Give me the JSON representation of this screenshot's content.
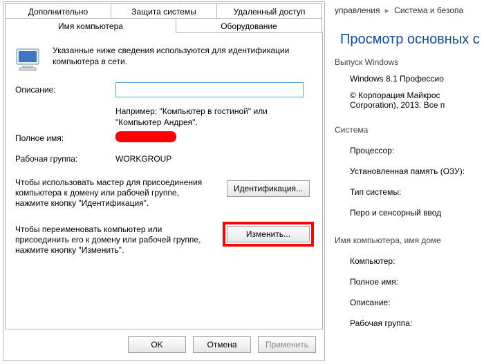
{
  "dialog": {
    "tabs": {
      "additional": "Дополнительно",
      "protection": "Защита системы",
      "remote": "Удаленный доступ",
      "computer_name": "Имя компьютера",
      "hardware": "Оборудование"
    },
    "intro": "Указанные ниже сведения используются для идентификации компьютера в сети.",
    "labels": {
      "description": "Описание:",
      "full_name": "Полное имя:",
      "workgroup": "Рабочая группа:"
    },
    "values": {
      "description": "",
      "full_name": "",
      "workgroup": "WORKGROUP"
    },
    "hint": "Например: \"Компьютер в гостиной\" или \"Компьютер Андрея\".",
    "wizard_text": "Чтобы использовать мастер для присоединения компьютера к домену или рабочей группе, нажмите кнопку \"Идентификация\".",
    "rename_text": "Чтобы переименовать компьютер или присоединить его к домену или рабочей группе, нажмите кнопку \"Изменить\".",
    "buttons": {
      "identify": "Идентификация...",
      "change": "Изменить...",
      "ok": "OK",
      "cancel": "Отмена",
      "apply": "Применить"
    }
  },
  "right": {
    "breadcrumb": {
      "part1": "управления",
      "part2": "Система и безопа"
    },
    "header": "Просмотр основных с",
    "group1_label": "Выпуск Windows",
    "edition": "Windows 8.1 Профессио",
    "copyright": "© Корпорация Майкрос Corporation), 2013. Все п",
    "group2_label": "Система",
    "proc": "Процессор:",
    "ram": "Установленная память (ОЗУ):",
    "type": "Тип системы:",
    "pen": "Перо и сенсорный ввод",
    "group3_label": "Имя компьютера, имя доме",
    "comp": "Компьютер:",
    "full": "Полное имя:",
    "desc": "Описание:",
    "wg": "Рабочая группа:"
  }
}
